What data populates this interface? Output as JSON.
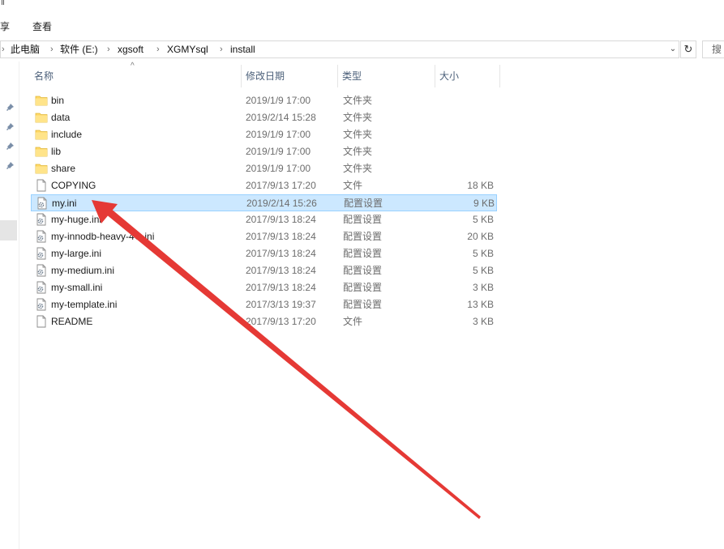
{
  "ribbon": {
    "tab_share": "享",
    "tab_view": "查看"
  },
  "address": {
    "crumbs": [
      "此电脑",
      "软件 (E:)",
      "xgsoft",
      "XGMYsql",
      "install"
    ],
    "search_placeholder": "搜"
  },
  "columns": {
    "name": "名称",
    "date": "修改日期",
    "type": "类型",
    "size": "大小"
  },
  "files": [
    {
      "name": "bin",
      "date": "2019/1/9 17:00",
      "type": "文件夹",
      "size": "",
      "icon": "folder-icon"
    },
    {
      "name": "data",
      "date": "2019/2/14 15:28",
      "type": "文件夹",
      "size": "",
      "icon": "folder-icon"
    },
    {
      "name": "include",
      "date": "2019/1/9 17:00",
      "type": "文件夹",
      "size": "",
      "icon": "folder-icon"
    },
    {
      "name": "lib",
      "date": "2019/1/9 17:00",
      "type": "文件夹",
      "size": "",
      "icon": "folder-icon"
    },
    {
      "name": "share",
      "date": "2019/1/9 17:00",
      "type": "文件夹",
      "size": "",
      "icon": "folder-icon"
    },
    {
      "name": "COPYING",
      "date": "2017/9/13 17:20",
      "type": "文件",
      "size": "18 KB",
      "icon": "file-icon"
    },
    {
      "name": "my.ini",
      "date": "2019/2/14 15:26",
      "type": "配置设置",
      "size": "9 KB",
      "icon": "settings-file-icon",
      "selected": true
    },
    {
      "name": "my-huge.ini",
      "date": "2017/9/13 18:24",
      "type": "配置设置",
      "size": "5 KB",
      "icon": "settings-file-icon"
    },
    {
      "name": "my-innodb-heavy-4G.ini",
      "date": "2017/9/13 18:24",
      "type": "配置设置",
      "size": "20 KB",
      "icon": "settings-file-icon"
    },
    {
      "name": "my-large.ini",
      "date": "2017/9/13 18:24",
      "type": "配置设置",
      "size": "5 KB",
      "icon": "settings-file-icon"
    },
    {
      "name": "my-medium.ini",
      "date": "2017/9/13 18:24",
      "type": "配置设置",
      "size": "5 KB",
      "icon": "settings-file-icon"
    },
    {
      "name": "my-small.ini",
      "date": "2017/9/13 18:24",
      "type": "配置设置",
      "size": "3 KB",
      "icon": "settings-file-icon"
    },
    {
      "name": "my-template.ini",
      "date": "2017/3/13 19:37",
      "type": "配置设置",
      "size": "13 KB",
      "icon": "settings-file-icon"
    },
    {
      "name": "README",
      "date": "2017/9/13 17:20",
      "type": "文件",
      "size": "3 KB",
      "icon": "file-icon"
    }
  ],
  "colors": {
    "selection_bg": "#cce8ff",
    "selection_border": "#99d1ff",
    "folder": "#ffd866",
    "arrow": "#e53935"
  }
}
